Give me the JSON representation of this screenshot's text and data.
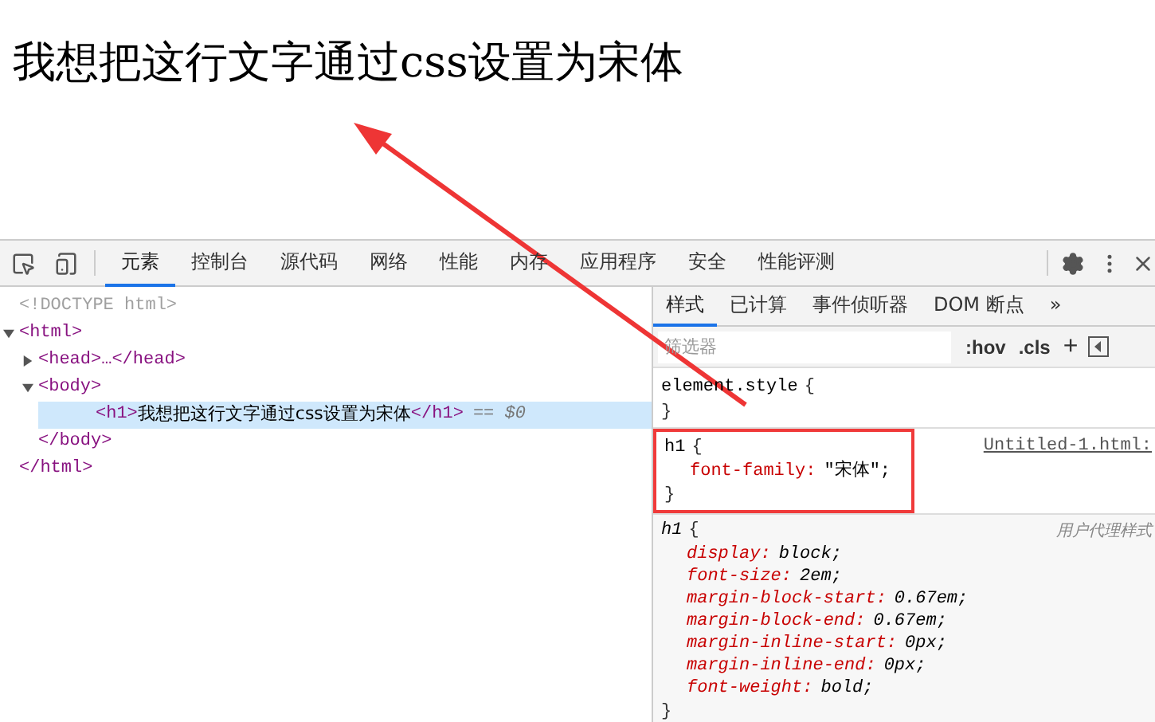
{
  "page": {
    "heading": "我想把这行文字通过css设置为宋体"
  },
  "devtools": {
    "tabs": [
      {
        "label": "元素",
        "selected": true
      },
      {
        "label": "控制台",
        "selected": false
      },
      {
        "label": "源代码",
        "selected": false
      },
      {
        "label": "网络",
        "selected": false
      },
      {
        "label": "性能",
        "selected": false
      },
      {
        "label": "内存",
        "selected": false
      },
      {
        "label": "应用程序",
        "selected": false
      },
      {
        "label": "安全",
        "selected": false
      },
      {
        "label": "性能评测",
        "selected": false
      }
    ],
    "dom_tree": [
      {
        "kind": "doctype",
        "text": "<!DOCTYPE html>"
      },
      {
        "kind": "element",
        "open": "<html>",
        "close": "</html>",
        "expanded": true,
        "children": [
          {
            "kind": "element",
            "open": "<head>…</head>",
            "expanded": false
          },
          {
            "kind": "element",
            "open": "<body>",
            "close": "</body>",
            "expanded": true,
            "children": [
              {
                "kind": "leaf",
                "open": "<h1>",
                "text": "我想把这行文字通过css设置为宋体",
                "close": "</h1>",
                "suffix": "== $0",
                "selected": true
              }
            ]
          }
        ]
      }
    ],
    "styles_tabs": [
      {
        "label": "样式",
        "selected": true
      },
      {
        "label": "已计算",
        "selected": false
      },
      {
        "label": "事件侦听器",
        "selected": false
      },
      {
        "label": "DOM 断点",
        "selected": false
      },
      {
        "label": "»",
        "selected": false
      }
    ],
    "filter": {
      "placeholder": "筛选器",
      "hov": ":hov",
      "cls": ".cls",
      "add": "+"
    },
    "rules": [
      {
        "selector": "element.style",
        "open": "{",
        "close": "}",
        "user_agent": false,
        "highlighted": false
      },
      {
        "selector": "h1",
        "open": "{",
        "close": "}",
        "source": "Untitled-1.html:",
        "user_agent": false,
        "highlighted": true,
        "declarations": [
          {
            "name": "font-family:",
            "value": "\"宋体\";"
          }
        ]
      },
      {
        "selector": "h1",
        "open": "{",
        "close": "}",
        "source": "用户代理样式",
        "user_agent": true,
        "highlighted": false,
        "declarations": [
          {
            "name": "display:",
            "value": "block;"
          },
          {
            "name": "font-size:",
            "value": "2em;"
          },
          {
            "name": "margin-block-start:",
            "value": "0.67em;"
          },
          {
            "name": "margin-block-end:",
            "value": "0.67em;"
          },
          {
            "name": "margin-inline-start:",
            "value": "0px;"
          },
          {
            "name": "margin-inline-end:",
            "value": "0px;"
          },
          {
            "name": "font-weight:",
            "value": "bold;"
          }
        ]
      }
    ]
  }
}
